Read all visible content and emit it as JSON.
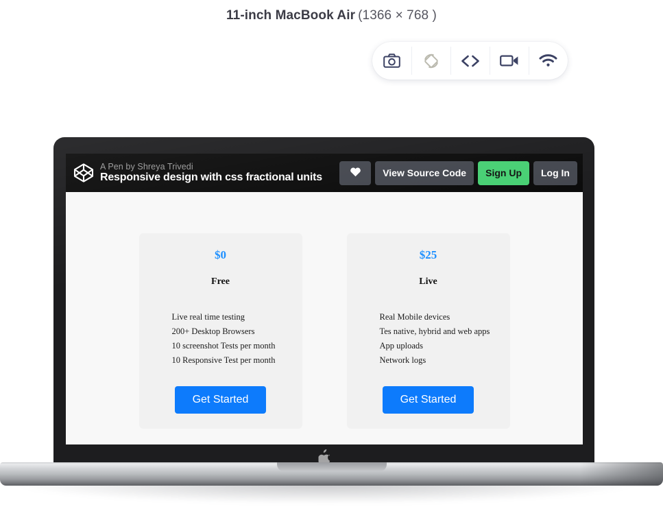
{
  "header": {
    "device_name": "11-inch MacBook Air",
    "resolution": "(1366 × 768 )"
  },
  "toolbar": {
    "buttons": [
      {
        "name": "screenshot",
        "icon": "camera-icon",
        "label": "Screenshot"
      },
      {
        "name": "rotate",
        "icon": "screen-rotation-icon",
        "label": "Rotate"
      },
      {
        "name": "inspect-code",
        "icon": "code-brackets-icon",
        "label": "Code"
      },
      {
        "name": "record-video",
        "icon": "video-camera-icon",
        "label": "Record"
      },
      {
        "name": "network",
        "icon": "wifi-icon",
        "label": "Network"
      }
    ],
    "icon_color": "#3c4264",
    "muted_icon_color": "#8a8777"
  },
  "codepen_bar": {
    "logo_icon": "codepen-logo-icon",
    "subtitle": "A Pen by Shreya Trivedi",
    "title": "Responsive design with css fractional units",
    "heart_icon": "heart-icon",
    "view_source_label": "View Source Code",
    "sign_up_label": "Sign Up",
    "log_in_label": "Log In",
    "background": "#0b0b0b",
    "button_color": "#44474f",
    "signup_color": "#47cf73"
  },
  "pricing": {
    "cards": [
      {
        "price": "$0",
        "plan": "Free",
        "features": [
          "Live real time testing",
          "200+ Desktop Browsers",
          "10 screenshot Tests per month",
          "10 Responsive Test per month"
        ],
        "cta": "Get Started"
      },
      {
        "price": "$25",
        "plan": "Live",
        "features": [
          "Real Mobile devices",
          "Tes native, hybrid and web apps",
          "App uploads",
          "Network logs"
        ],
        "cta": "Get Started"
      }
    ],
    "price_color": "#1e90ff",
    "cta_color": "#0d7bfc",
    "card_background": "#f1f1f1",
    "page_background": "#f8f8f8"
  },
  "laptop": {
    "brand_icon": "apple-logo-icon",
    "bezel_color": "#1d1d1f",
    "base_color": "#b6b9bc"
  }
}
